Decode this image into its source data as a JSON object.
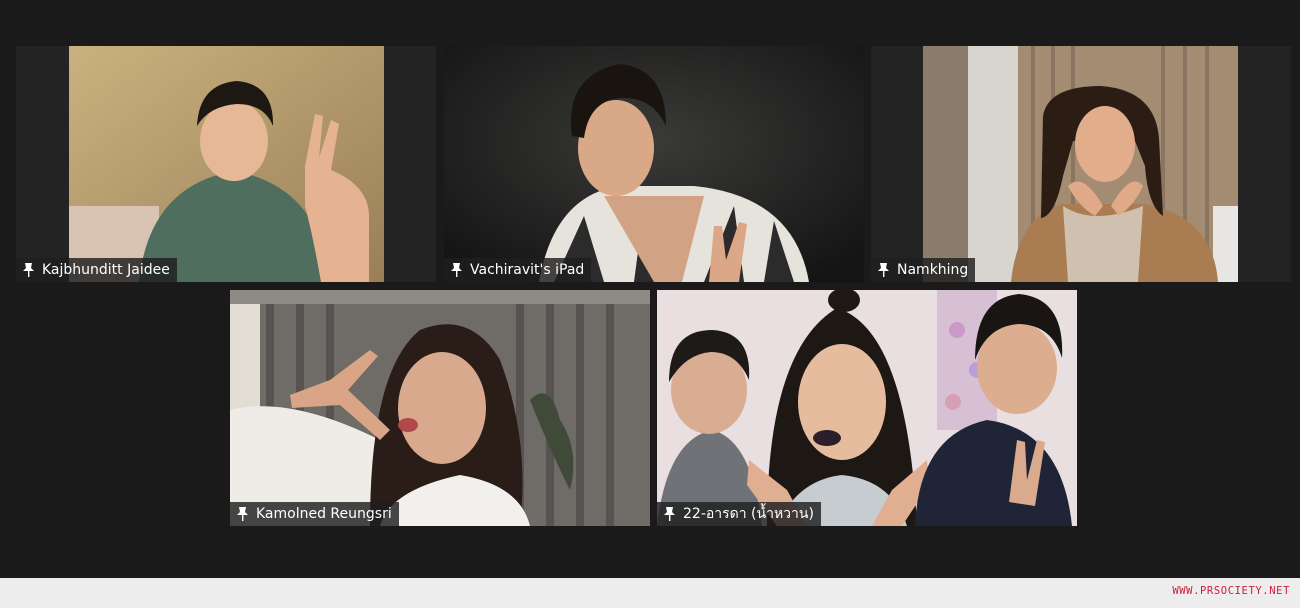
{
  "meeting": {
    "participants": [
      {
        "name": "Kajbhunditt Jaidee",
        "pinned": true
      },
      {
        "name": "Vachiravit's iPad",
        "pinned": true
      },
      {
        "name": "Namkhing",
        "pinned": true
      },
      {
        "name": "Kamolned Reungsri",
        "pinned": true
      },
      {
        "name": "22-อารดา (น้ำหวาน)",
        "pinned": true
      }
    ]
  },
  "footer": {
    "watermark": "WWW.PRSOCIETY.NET"
  },
  "colors": {
    "background": "#1a1a1a",
    "footer_background": "#ededed",
    "watermark": "#cc1e3a",
    "name_tag_background": "#1e1e1e"
  }
}
